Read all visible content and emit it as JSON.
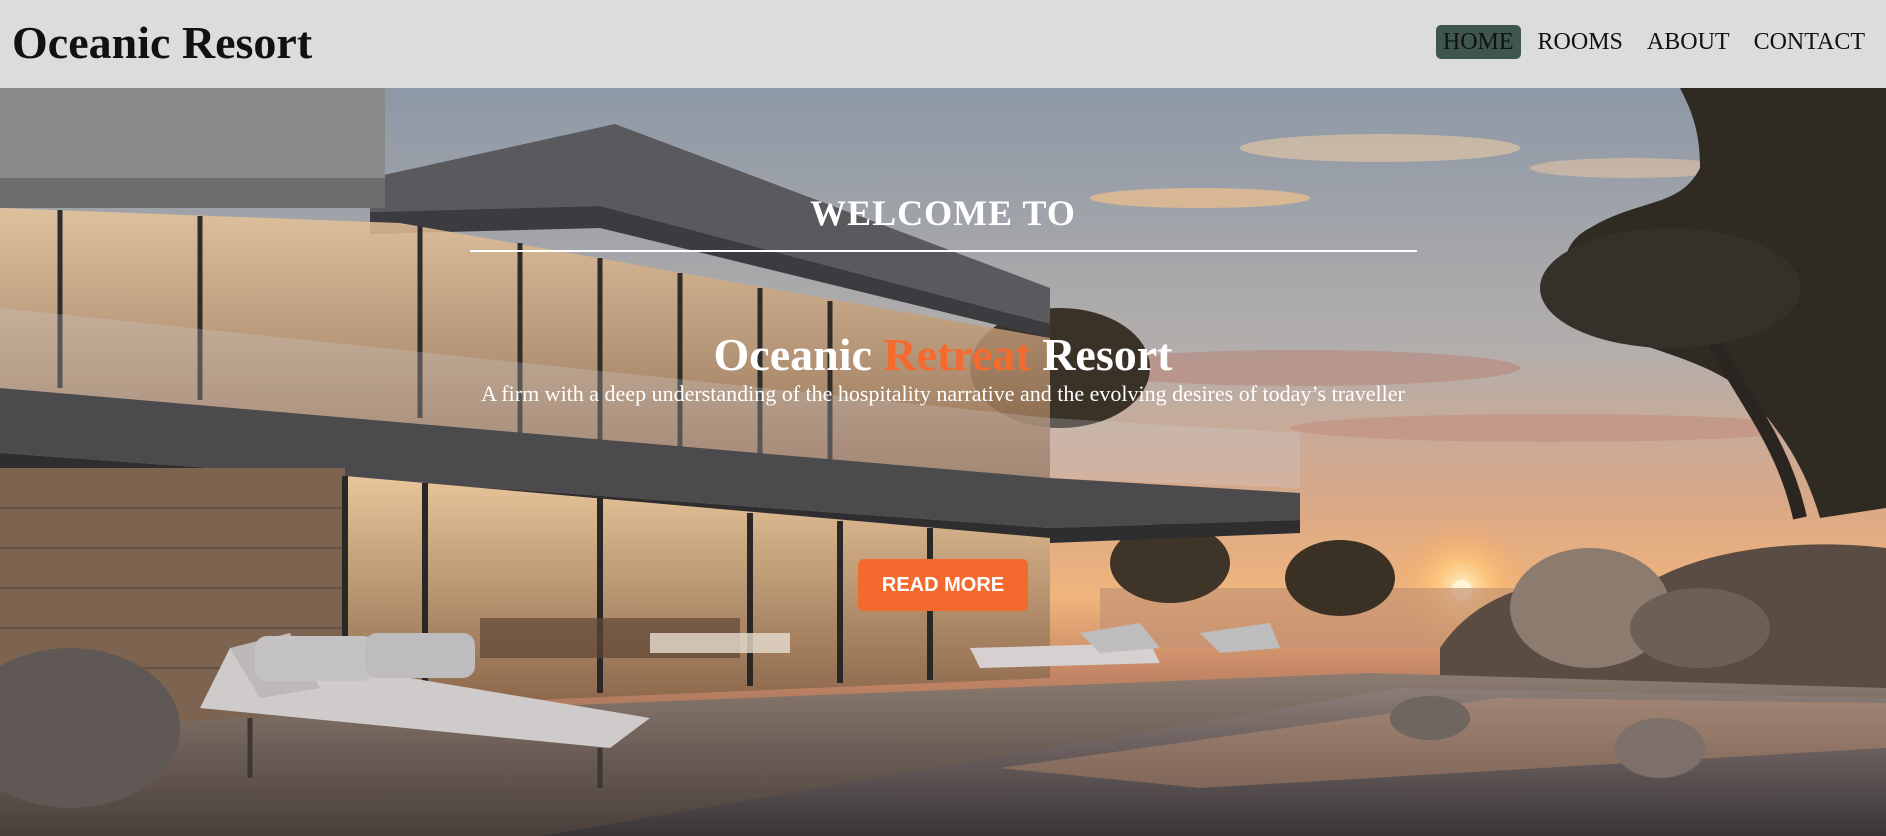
{
  "header": {
    "brand": "Oceanic Resort",
    "nav": [
      {
        "label": "HOME",
        "active": true
      },
      {
        "label": "ROOMS",
        "active": false
      },
      {
        "label": "ABOUT",
        "active": false
      },
      {
        "label": "CONTACT",
        "active": false
      }
    ]
  },
  "hero": {
    "welcome": "WELCOME TO",
    "title_part1": "Oceanic ",
    "title_accent": "Retreat",
    "title_part2": " Resort",
    "tagline": "A firm with a deep understanding of the hospitality narrative and the evolving desires of today’s traveller",
    "cta_label": "READ MORE"
  },
  "colors": {
    "accent": "#f56a2f",
    "active_nav_bg": "#3f5650",
    "header_bg": "#dcdcdc"
  }
}
